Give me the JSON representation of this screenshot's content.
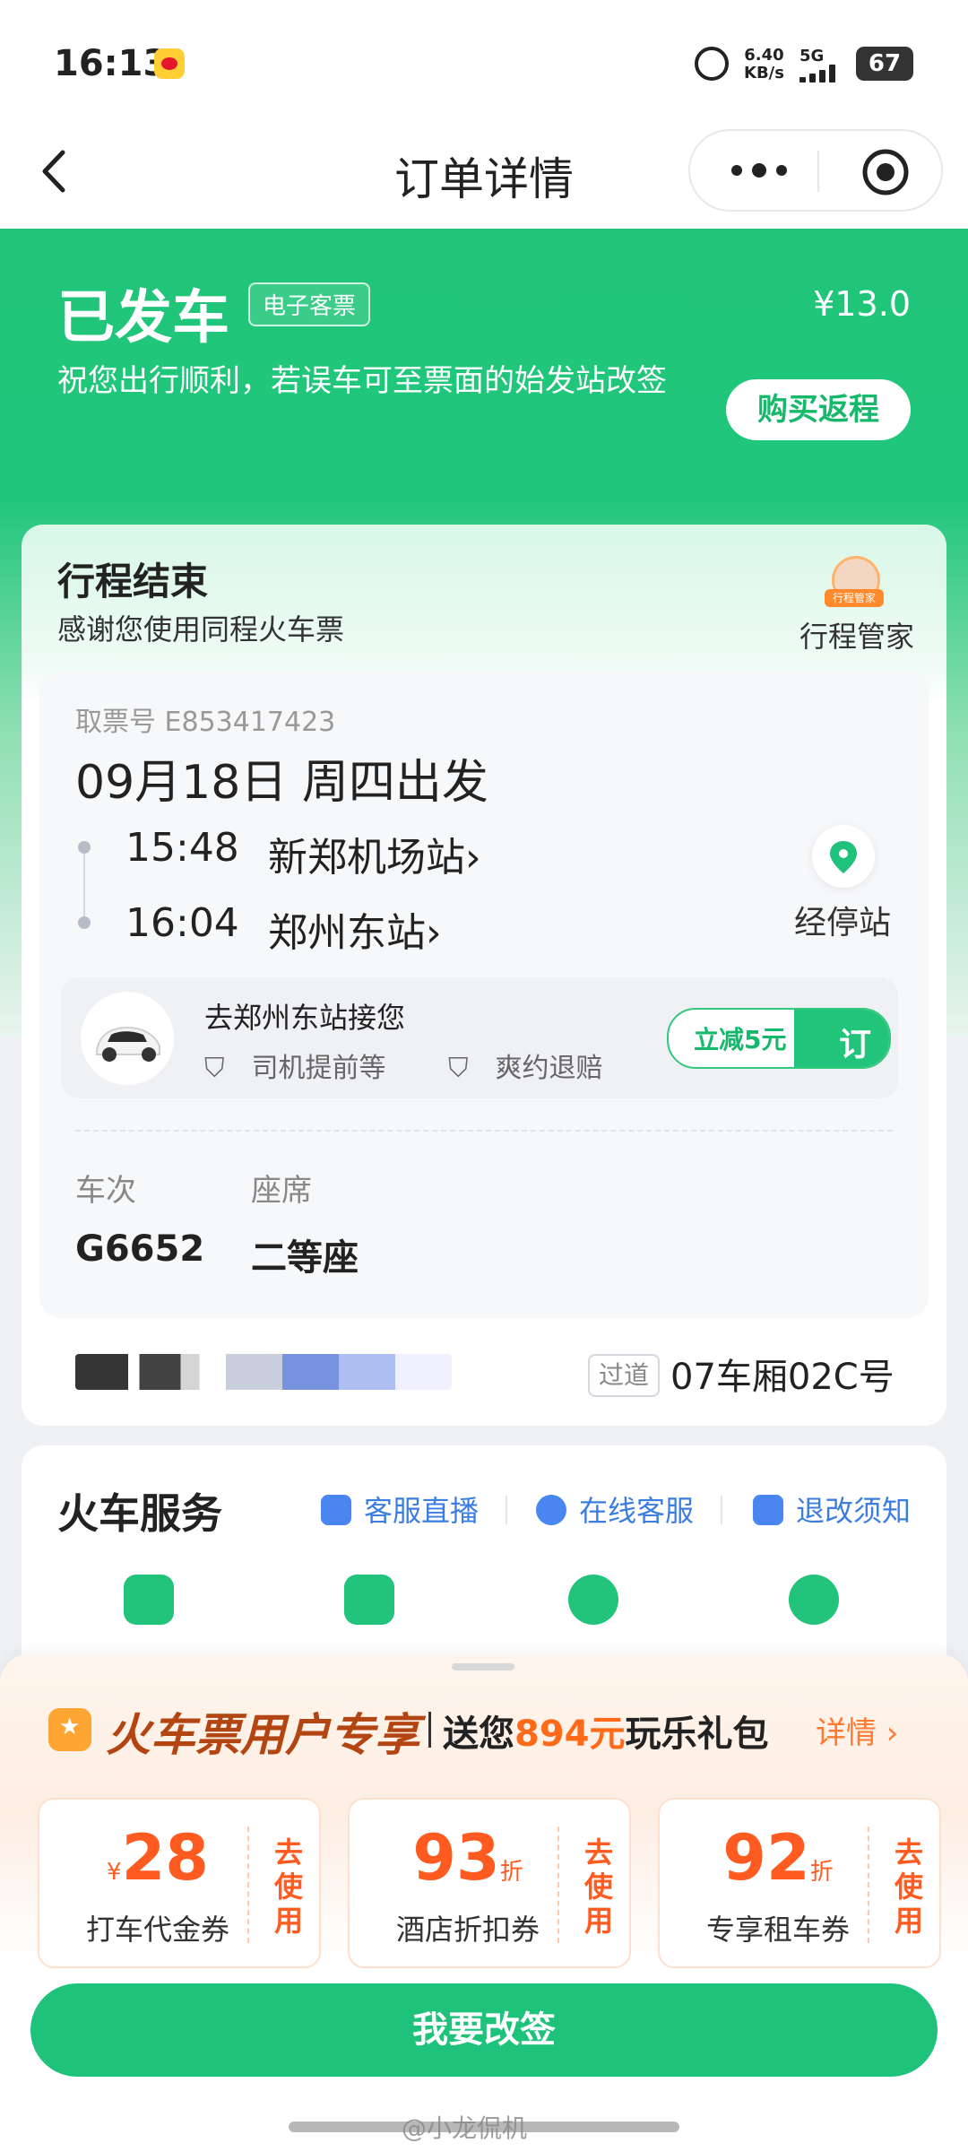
{
  "status_bar": {
    "time": "16:13",
    "net_speed": "6.40",
    "net_unit": "KB/s",
    "signal": "5G",
    "battery": "67"
  },
  "nav": {
    "title": "订单详情"
  },
  "order": {
    "status": "已发车",
    "ticket_type_tag": "电子客票",
    "price": "¥13.0",
    "tip": "祝您出行顺利，若误车可至票面的始发站改签",
    "return_button": "购买返程"
  },
  "trip": {
    "end_title": "行程结束",
    "end_subtitle": "感谢您使用同程火车票",
    "butler_badge": "行程管家",
    "butler_label": "行程管家",
    "ticket_no": "取票号 E853417423",
    "departure": "09月18日 周四出发",
    "stops": [
      {
        "time": "15:48",
        "station": "新郑机场站",
        "chevron": "›"
      },
      {
        "time": "16:04",
        "station": "郑州东站",
        "chevron": "›"
      }
    ],
    "stop_label": "经停站",
    "pickup": {
      "title": "去郑州东站接您",
      "tags": [
        "司机提前等",
        "爽约退赔"
      ],
      "deal": "立减5元",
      "book": "订"
    },
    "train_label": "车次",
    "seat_label": "座席",
    "train_no": "G6652",
    "seat_class": "二等座",
    "aisle_tag": "过道",
    "seat_no": "07车厢02C号"
  },
  "services": {
    "title": "火车服务",
    "links": [
      {
        "label": "客服直播",
        "icon": "tv-icon"
      },
      {
        "label": "在线客服",
        "icon": "headset-icon"
      },
      {
        "label": "退改须知",
        "icon": "doc-icon"
      }
    ]
  },
  "promo": {
    "brand": "火车票用户专享",
    "offer_prefix": "送您",
    "offer_amount": "894元",
    "offer_suffix": "玩乐礼包",
    "details": "详情 ›",
    "coupons": [
      {
        "currency": "¥",
        "value": "28",
        "unit": "",
        "name": "打车代金券",
        "action": "去使用"
      },
      {
        "currency": "",
        "value": "93",
        "unit": "折",
        "name": "酒店折扣券",
        "action": "去使用"
      },
      {
        "currency": "",
        "value": "92",
        "unit": "折",
        "name": "专享租车券",
        "action": "去使用"
      }
    ]
  },
  "cta": "我要改签",
  "watermark": "@小龙侃机",
  "colors": {
    "brand_green": "#1ec27a",
    "promo_orange": "#ff5a1f",
    "link_blue": "#3b7de0"
  }
}
